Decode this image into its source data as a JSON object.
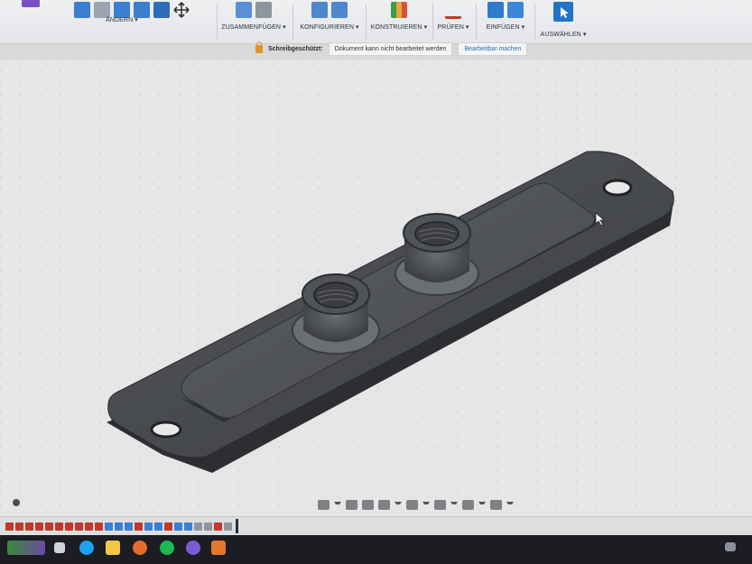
{
  "toolbar": {
    "groups": [
      {
        "id": "aendern",
        "label": "ÄNDERN ▾"
      },
      {
        "id": "zusammenfuegen",
        "label": "ZUSAMMENFÜGEN ▾"
      },
      {
        "id": "konfigurieren",
        "label": "KONFIGURIEREN ▾"
      },
      {
        "id": "konstruieren",
        "label": "KONSTRUIEREN ▾"
      },
      {
        "id": "pruefen",
        "label": "PRÜFEN ▾"
      },
      {
        "id": "einfuegen",
        "label": "EINFÜGEN ▾"
      },
      {
        "id": "auswaehlen",
        "label": "AUSWÄHLEN ▾"
      }
    ]
  },
  "banner": {
    "title": "Schreibgeschützt:",
    "message": "Dokument kann nicht bearbeitet werden",
    "action": "Bearbeitbar machen"
  },
  "colors": {
    "accent": "#2a6fb3",
    "warning": "#e49425",
    "model": "#3e4044"
  }
}
